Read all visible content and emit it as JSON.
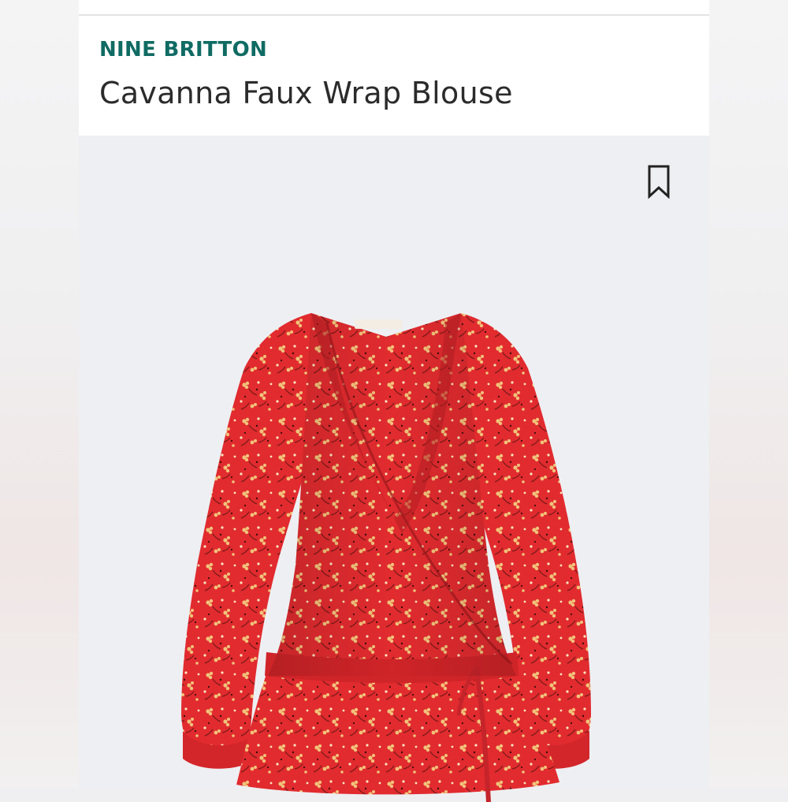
{
  "product": {
    "brand": "NINE BRITTON",
    "name": "Cavanna Faux Wrap Blouse"
  },
  "icons": {
    "save": "bookmark-icon"
  },
  "colors": {
    "brand": "#0f6b63",
    "title": "#2b2b2b",
    "garment": "#e12b2f",
    "print": "#f1c27a"
  }
}
